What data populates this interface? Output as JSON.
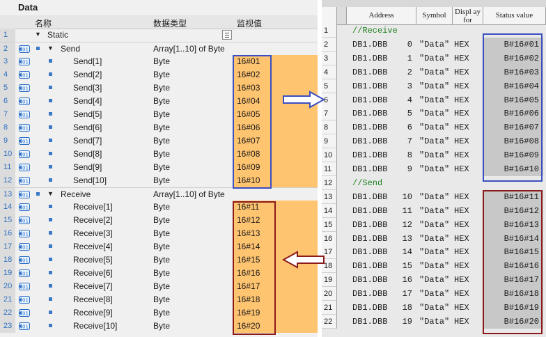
{
  "left": {
    "title": "Data",
    "columns": {
      "name": "名称",
      "type": "数据类型",
      "monitor": "监视值"
    },
    "rows": [
      {
        "num": "1",
        "name": "Static",
        "type": "",
        "value": "",
        "level": 0
      },
      {
        "num": "2",
        "name": "Send",
        "type": "Array[1..10] of Byte",
        "value": "",
        "level": 1
      },
      {
        "num": "3",
        "name": "Send[1]",
        "type": "Byte",
        "value": "16#01",
        "level": 2
      },
      {
        "num": "4",
        "name": "Send[2]",
        "type": "Byte",
        "value": "16#02",
        "level": 2
      },
      {
        "num": "5",
        "name": "Send[3]",
        "type": "Byte",
        "value": "16#03",
        "level": 2
      },
      {
        "num": "6",
        "name": "Send[4]",
        "type": "Byte",
        "value": "16#04",
        "level": 2
      },
      {
        "num": "7",
        "name": "Send[5]",
        "type": "Byte",
        "value": "16#05",
        "level": 2
      },
      {
        "num": "8",
        "name": "Send[6]",
        "type": "Byte",
        "value": "16#06",
        "level": 2
      },
      {
        "num": "9",
        "name": "Send[7]",
        "type": "Byte",
        "value": "16#07",
        "level": 2
      },
      {
        "num": "10",
        "name": "Send[8]",
        "type": "Byte",
        "value": "16#08",
        "level": 2
      },
      {
        "num": "11",
        "name": "Send[9]",
        "type": "Byte",
        "value": "16#09",
        "level": 2
      },
      {
        "num": "12",
        "name": "Send[10]",
        "type": "Byte",
        "value": "16#10",
        "level": 2
      },
      {
        "num": "13",
        "name": "Receive",
        "type": "Array[1..10] of Byte",
        "value": "",
        "level": 1
      },
      {
        "num": "14",
        "name": "Receive[1]",
        "type": "Byte",
        "value": "16#11",
        "level": 2
      },
      {
        "num": "15",
        "name": "Receive[2]",
        "type": "Byte",
        "value": "16#12",
        "level": 2
      },
      {
        "num": "16",
        "name": "Receive[3]",
        "type": "Byte",
        "value": "16#13",
        "level": 2
      },
      {
        "num": "17",
        "name": "Receive[4]",
        "type": "Byte",
        "value": "16#14",
        "level": 2
      },
      {
        "num": "18",
        "name": "Receive[5]",
        "type": "Byte",
        "value": "16#15",
        "level": 2
      },
      {
        "num": "19",
        "name": "Receive[6]",
        "type": "Byte",
        "value": "16#16",
        "level": 2
      },
      {
        "num": "20",
        "name": "Receive[7]",
        "type": "Byte",
        "value": "16#17",
        "level": 2
      },
      {
        "num": "21",
        "name": "Receive[8]",
        "type": "Byte",
        "value": "16#18",
        "level": 2
      },
      {
        "num": "22",
        "name": "Receive[9]",
        "type": "Byte",
        "value": "16#19",
        "level": 2
      },
      {
        "num": "23",
        "name": "Receive[10]",
        "type": "Byte",
        "value": "16#20",
        "level": 2
      }
    ]
  },
  "right": {
    "columns": {
      "address": "Address",
      "symbol": "Symbol",
      "display": "Displ ay for",
      "status": "Status value"
    },
    "rows": [
      {
        "num": "1",
        "comment": "//Receive"
      },
      {
        "num": "2",
        "addr": "DB1.DBB",
        "idx": "0",
        "symbol": "\"Data\"",
        "fmt": "HEX",
        "status": "B#16#01"
      },
      {
        "num": "3",
        "addr": "DB1.DBB",
        "idx": "1",
        "symbol": "\"Data\"",
        "fmt": "HEX",
        "status": "B#16#02"
      },
      {
        "num": "4",
        "addr": "DB1.DBB",
        "idx": "2",
        "symbol": "\"Data\"",
        "fmt": "HEX",
        "status": "B#16#03"
      },
      {
        "num": "5",
        "addr": "DB1.DBB",
        "idx": "3",
        "symbol": "\"Data\"",
        "fmt": "HEX",
        "status": "B#16#04"
      },
      {
        "num": "6",
        "addr": "DB1.DBB",
        "idx": "4",
        "symbol": "\"Data\"",
        "fmt": "HEX",
        "status": "B#16#05"
      },
      {
        "num": "7",
        "addr": "DB1.DBB",
        "idx": "5",
        "symbol": "\"Data\"",
        "fmt": "HEX",
        "status": "B#16#06"
      },
      {
        "num": "8",
        "addr": "DB1.DBB",
        "idx": "6",
        "symbol": "\"Data\"",
        "fmt": "HEX",
        "status": "B#16#07"
      },
      {
        "num": "9",
        "addr": "DB1.DBB",
        "idx": "7",
        "symbol": "\"Data\"",
        "fmt": "HEX",
        "status": "B#16#08"
      },
      {
        "num": "10",
        "addr": "DB1.DBB",
        "idx": "8",
        "symbol": "\"Data\"",
        "fmt": "HEX",
        "status": "B#16#09"
      },
      {
        "num": "11",
        "addr": "DB1.DBB",
        "idx": "9",
        "symbol": "\"Data\"",
        "fmt": "HEX",
        "status": "B#16#10"
      },
      {
        "num": "12",
        "comment": "//Send"
      },
      {
        "num": "13",
        "addr": "DB1.DBB",
        "idx": "10",
        "symbol": "\"Data\"",
        "fmt": "HEX",
        "status": "B#16#11"
      },
      {
        "num": "14",
        "addr": "DB1.DBB",
        "idx": "11",
        "symbol": "\"Data\"",
        "fmt": "HEX",
        "status": "B#16#12"
      },
      {
        "num": "15",
        "addr": "DB1.DBB",
        "idx": "12",
        "symbol": "\"Data\"",
        "fmt": "HEX",
        "status": "B#16#13"
      },
      {
        "num": "16",
        "addr": "DB1.DBB",
        "idx": "13",
        "symbol": "\"Data\"",
        "fmt": "HEX",
        "status": "B#16#14"
      },
      {
        "num": "17",
        "addr": "DB1.DBB",
        "idx": "14",
        "symbol": "\"Data\"",
        "fmt": "HEX",
        "status": "B#16#15"
      },
      {
        "num": "18",
        "addr": "DB1.DBB",
        "idx": "15",
        "symbol": "\"Data\"",
        "fmt": "HEX",
        "status": "B#16#16"
      },
      {
        "num": "19",
        "addr": "DB1.DBB",
        "idx": "16",
        "symbol": "\"Data\"",
        "fmt": "HEX",
        "status": "B#16#17"
      },
      {
        "num": "20",
        "addr": "DB1.DBB",
        "idx": "17",
        "symbol": "\"Data\"",
        "fmt": "HEX",
        "status": "B#16#18"
      },
      {
        "num": "21",
        "addr": "DB1.DBB",
        "idx": "18",
        "symbol": "\"Data\"",
        "fmt": "HEX",
        "status": "B#16#19"
      },
      {
        "num": "22",
        "addr": "DB1.DBB",
        "idx": "19",
        "symbol": "\"Data\"",
        "fmt": "HEX",
        "status": "B#16#20"
      }
    ]
  },
  "colors": {
    "monitor_fill": "#ffc470",
    "blue_box": "#3a4fc0",
    "red_box": "#8b1a1a",
    "comment": "#208020",
    "status_fill": "#c8c8c8"
  }
}
